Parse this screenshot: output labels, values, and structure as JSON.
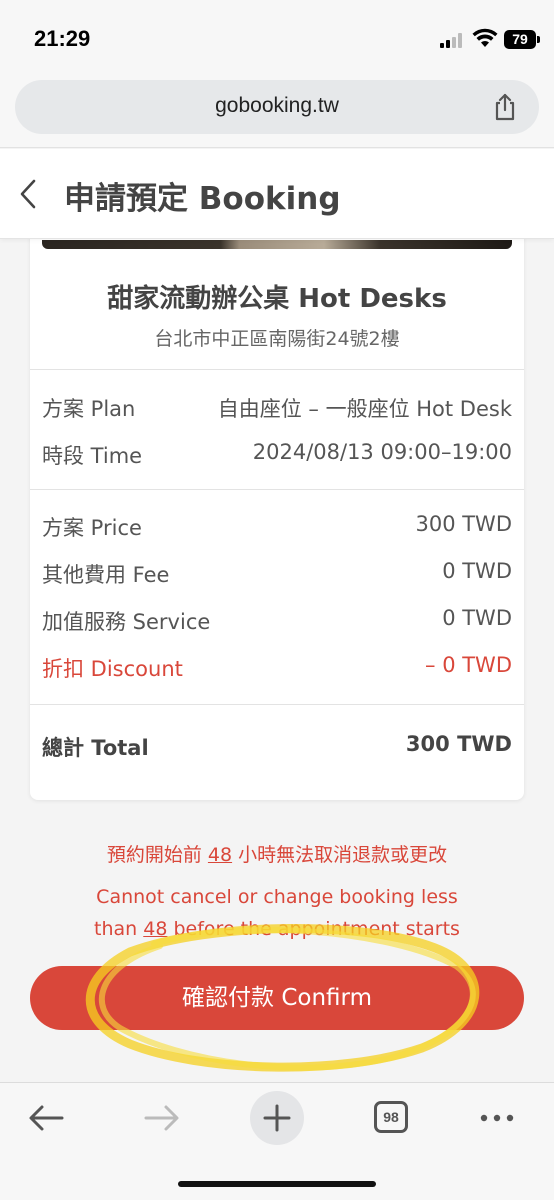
{
  "status_bar": {
    "time": "21:29",
    "battery": "79"
  },
  "browser": {
    "url": "gobooking.tw"
  },
  "header": {
    "title": "申請預定 Booking"
  },
  "venue": {
    "name": "甜家流動辦公桌 Hot Desks",
    "address": "台北市中正區南陽街24號2樓"
  },
  "details": [
    {
      "label": "方案 Plan",
      "value": "自由座位 – 一般座位 Hot Desk"
    },
    {
      "label": "時段 Time",
      "value": "2024/08/13   09:00–19:00"
    }
  ],
  "pricing": [
    {
      "label": "方案 Price",
      "value": "300 TWD"
    },
    {
      "label": "其他費用 Fee",
      "value": "0 TWD"
    },
    {
      "label": "加值服務 Service",
      "value": "0 TWD"
    },
    {
      "label": "折扣 Discount",
      "value": "– 0 TWD"
    }
  ],
  "total": {
    "label": "總計 Total",
    "value": "300 TWD"
  },
  "notice": {
    "zh_before": "預約開始前 ",
    "zh_hours": "48",
    "zh_after": " 小時無法取消退款或更改",
    "en_line1": "Cannot cancel or change booking less",
    "en_before": "than ",
    "en_hours": "48",
    "en_after": " before the appointment starts"
  },
  "confirm": {
    "label": "確認付款 Confirm"
  },
  "toolbar": {
    "tabs_count": "98"
  },
  "colors": {
    "accent": "#d9473a",
    "highlight": "#f5d020"
  }
}
